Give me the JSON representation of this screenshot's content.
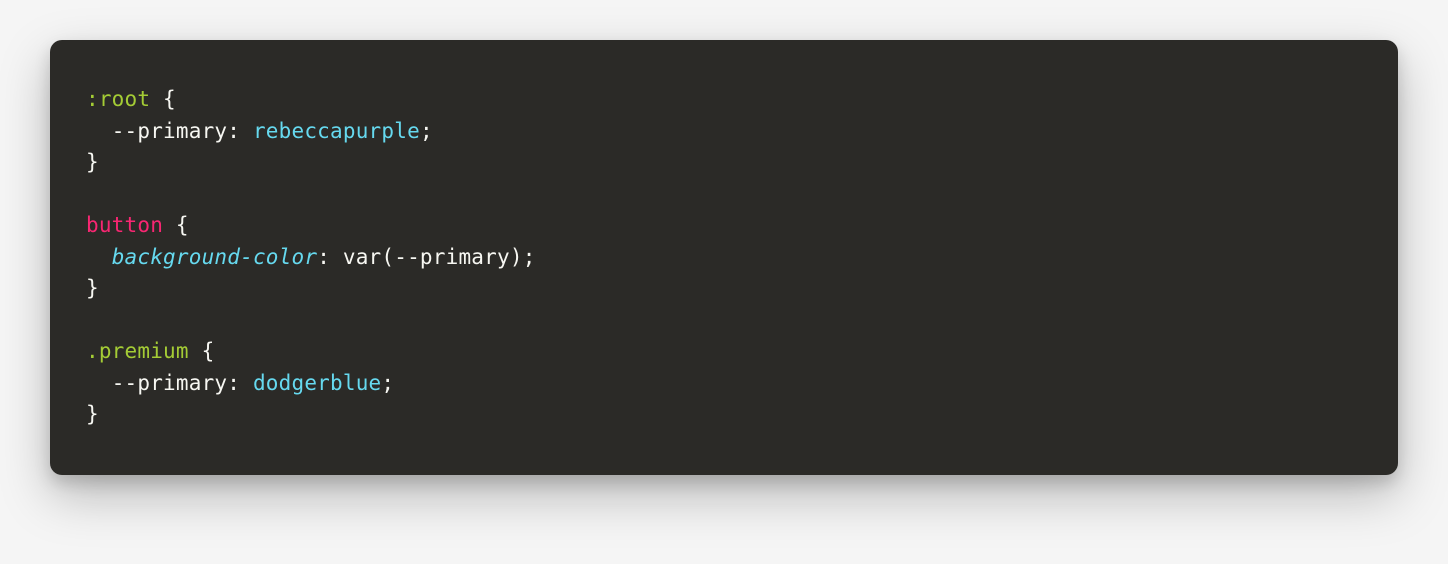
{
  "code": {
    "rule1": {
      "selector": ":root",
      "brace_open": " {",
      "indent": "  ",
      "prop_name": "--primary",
      "colon": ": ",
      "value": "rebeccapurple",
      "semi": ";",
      "brace_close": "}"
    },
    "rule2": {
      "selector": "button",
      "brace_open": " {",
      "indent": "  ",
      "prop_name": "background-color",
      "colon": ": ",
      "func_name": "var",
      "paren_open": "(",
      "arg": "--primary",
      "paren_close": ")",
      "semi": ";",
      "brace_close": "}"
    },
    "rule3": {
      "selector": ".premium",
      "brace_open": " {",
      "indent": "  ",
      "prop_name": "--primary",
      "colon": ": ",
      "value": "dodgerblue",
      "semi": ";",
      "brace_close": "}"
    },
    "blank": ""
  }
}
